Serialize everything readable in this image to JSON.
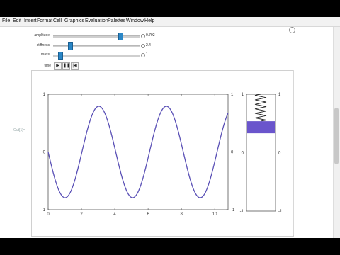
{
  "menu": [
    "File",
    "Edit",
    "Insert",
    "Format",
    "Cell",
    "Graphics",
    "Evaluation",
    "Palettes",
    "Window",
    "Help"
  ],
  "controls": {
    "sliders": [
      {
        "label": "amplitude",
        "value": "0.792",
        "fraction": 0.79
      },
      {
        "label": "stiffness",
        "value": "2.4",
        "fraction": 0.18
      },
      {
        "label": "mass",
        "value": "1",
        "fraction": 0.06
      }
    ],
    "time_label": "time",
    "buttons": {
      "play": "▶",
      "pause": "❚❚",
      "reset": "|◀"
    }
  },
  "output_label": "Out[1]=",
  "chart_data": [
    {
      "type": "line",
      "x_range": [
        0,
        10.8
      ],
      "y_range": [
        -1,
        1
      ],
      "xticks": [
        "0",
        "2",
        "4",
        "6",
        "8",
        "10"
      ],
      "yticks_left": [
        "1",
        "0",
        "-1"
      ],
      "yticks_right": [
        "1",
        "0",
        "-1"
      ],
      "amplitude": 0.792,
      "stiffness": 2.4,
      "mass": 1,
      "series": [
        {
          "function": "-amplitude*sin(sqrt(stiffness/mass)*t)",
          "color": "#5a50b6"
        }
      ]
    },
    {
      "type": "spring",
      "y_range": [
        -1,
        1
      ],
      "yticks_left": [
        "1",
        "0",
        "-1"
      ],
      "yticks_right": [
        "1",
        "0",
        "-1"
      ],
      "mass_position": 0.55,
      "mass_color": "#6a55cc"
    }
  ]
}
